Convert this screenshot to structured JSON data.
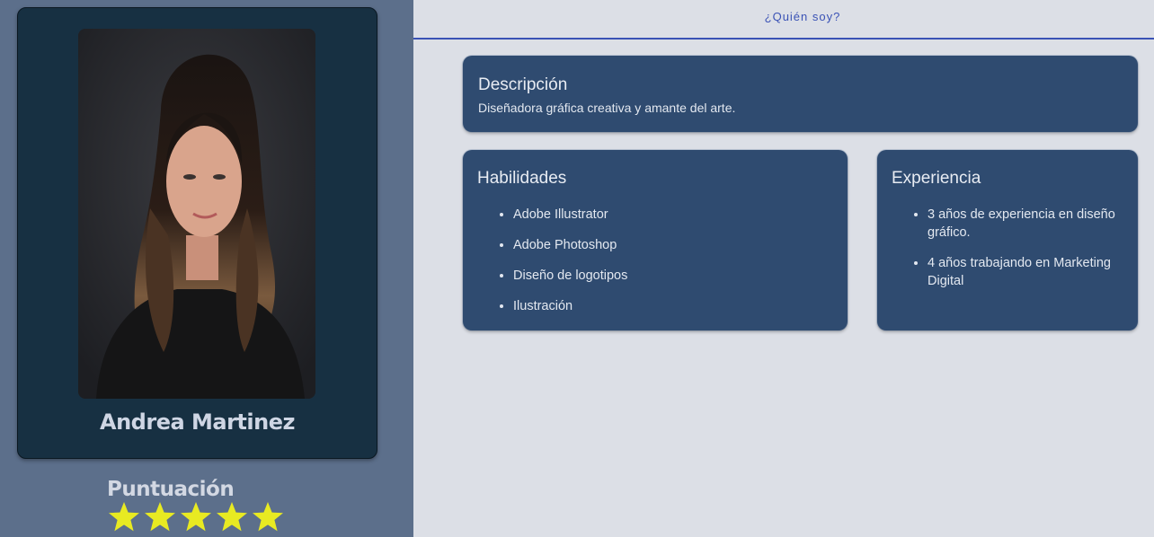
{
  "profile": {
    "name": "Andrea Martinez",
    "photo_alt": "Andrea Martinez"
  },
  "rating": {
    "title": "Puntuación",
    "stars": 5,
    "max_stars": 5,
    "star_color": "#e8ea22"
  },
  "header": {
    "tab_label": "¿Quién soy?"
  },
  "description": {
    "title": "Descripción",
    "text": "Diseñadora gráfica creativa y amante del arte."
  },
  "skills": {
    "title": "Habilidades",
    "items": [
      "Adobe Illustrator",
      "Adobe Photoshop",
      "Diseño de logotipos",
      "Ilustración"
    ]
  },
  "experience": {
    "title": "Experiencia",
    "items": [
      "3 años de experiencia en diseño gráfico.",
      "4 años trabajando en Marketing Digital"
    ]
  },
  "colors": {
    "sidebar_bg": "#5c6f8b",
    "profile_card_bg": "#173042",
    "content_bg": "#dcdfe6",
    "card_bg": "#2f4b70",
    "accent": "#3a52b5"
  }
}
